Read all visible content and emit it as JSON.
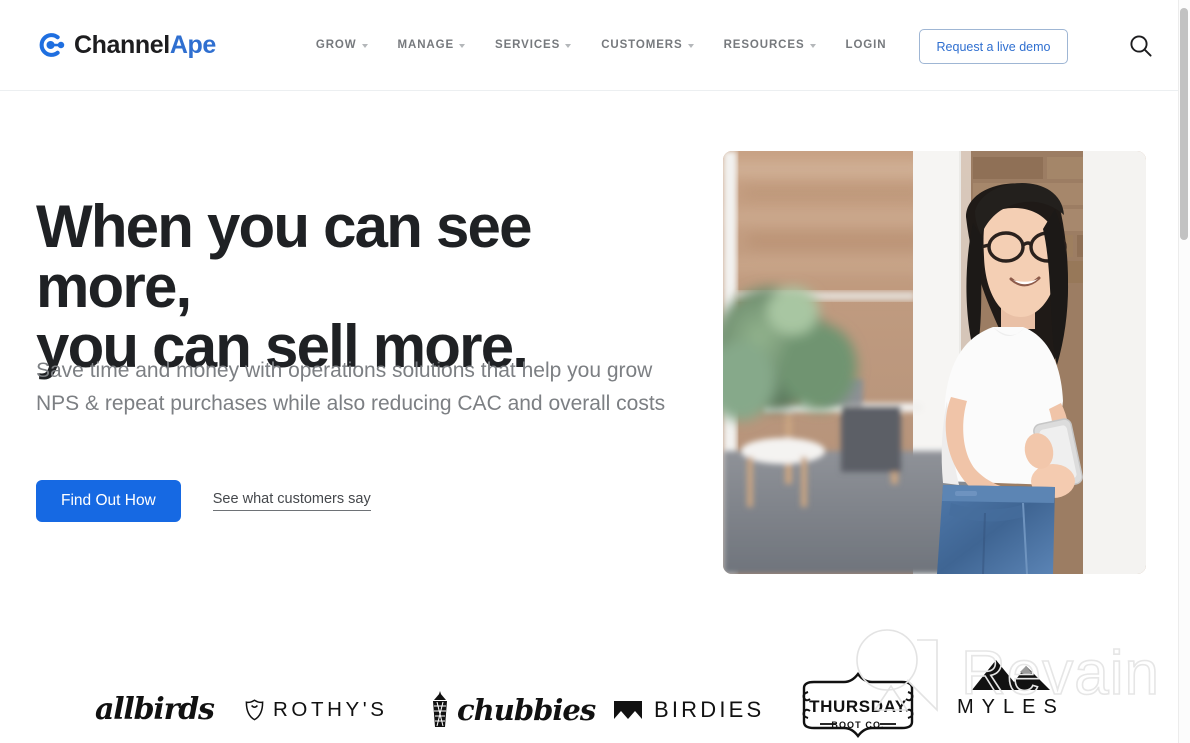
{
  "header": {
    "logo": {
      "text_dark": "Channel",
      "text_blue": "Ape",
      "mark": "channelape-logo-icon"
    },
    "nav": [
      {
        "label": "GROW",
        "has_dropdown": true
      },
      {
        "label": "MANAGE",
        "has_dropdown": true
      },
      {
        "label": "SERVICES",
        "has_dropdown": true
      },
      {
        "label": "CUSTOMERS",
        "has_dropdown": true
      },
      {
        "label": "RESOURCES",
        "has_dropdown": true
      },
      {
        "label": "LOGIN",
        "has_dropdown": false
      }
    ],
    "demo_button": "Request a live demo",
    "search_icon": "search-icon"
  },
  "hero": {
    "headline_line1": "When you can see more,",
    "headline_line2": "you can sell more.",
    "subhead": "Save time and money with operations solutions that help you grow NPS & repeat purchases while also reducing CAC and overall costs",
    "primary_cta": "Find Out How",
    "secondary_cta": "See what customers say",
    "image_alt": "woman-with-glasses-holding-phone-photo"
  },
  "brands": [
    {
      "name": "allbirds",
      "label": "allbirds"
    },
    {
      "name": "rothys",
      "label": "ROTHY'S"
    },
    {
      "name": "chubbies",
      "label": "chubbies"
    },
    {
      "name": "birdies",
      "label": "BIRDIES"
    },
    {
      "name": "thursday-boot-co",
      "label": "THURSDAY",
      "sublabel": "BOOT CO."
    },
    {
      "name": "myles",
      "label": "MYLES"
    }
  ],
  "watermark": {
    "label": "Revain"
  },
  "colors": {
    "accent_blue": "#1669e3",
    "logo_blue": "#2f6fd0",
    "nav_gray": "#76797d",
    "headline": "#1f2124",
    "subhead": "#7c7f83"
  }
}
